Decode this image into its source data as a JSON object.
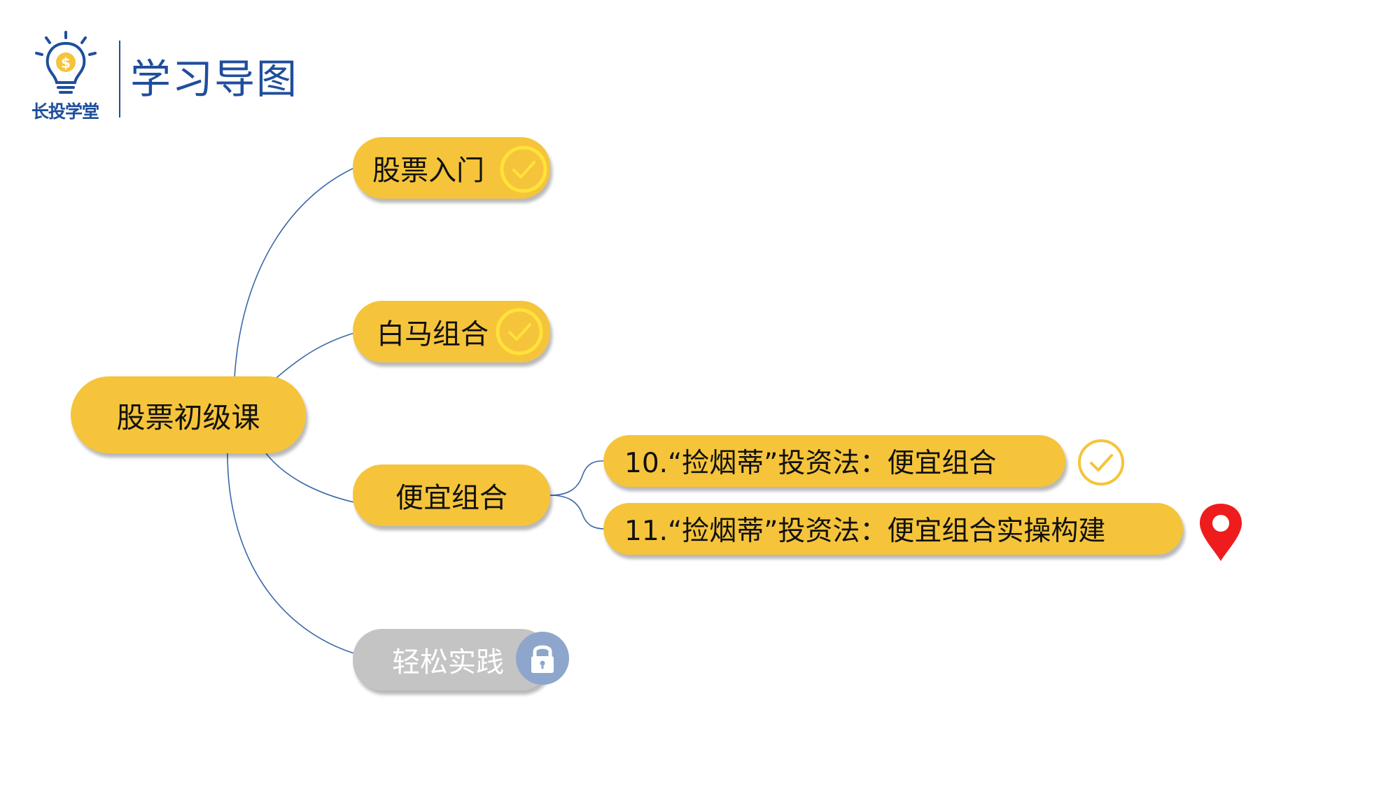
{
  "header": {
    "logo_text": "长投学堂",
    "title": "学习导图"
  },
  "colors": {
    "node_fill": "#f5c43a",
    "locked_fill": "#c4c4c4",
    "brand_blue": "#1f4e9c",
    "connector": "#3b68a8",
    "check_yellow": "#ffe23a",
    "pin_red": "#ee1c1c",
    "lock_badge": "#8ea6cc"
  },
  "mindmap": {
    "root": {
      "label": "股票初级课"
    },
    "branches": [
      {
        "label": "股票入门",
        "status": "completed",
        "icon": "check-icon"
      },
      {
        "label": "白马组合",
        "status": "completed",
        "icon": "check-icon"
      },
      {
        "label": "便宜组合",
        "status": "in-progress",
        "children": [
          {
            "label": "10.“捡烟蒂”投资法：便宜组合",
            "status": "completed",
            "icon": "check-icon"
          },
          {
            "label": "11.“捡烟蒂”投资法：便宜组合实操构建",
            "status": "current",
            "icon": "location-pin-icon"
          }
        ]
      },
      {
        "label": "轻松实践",
        "status": "locked",
        "icon": "lock-icon"
      }
    ]
  }
}
